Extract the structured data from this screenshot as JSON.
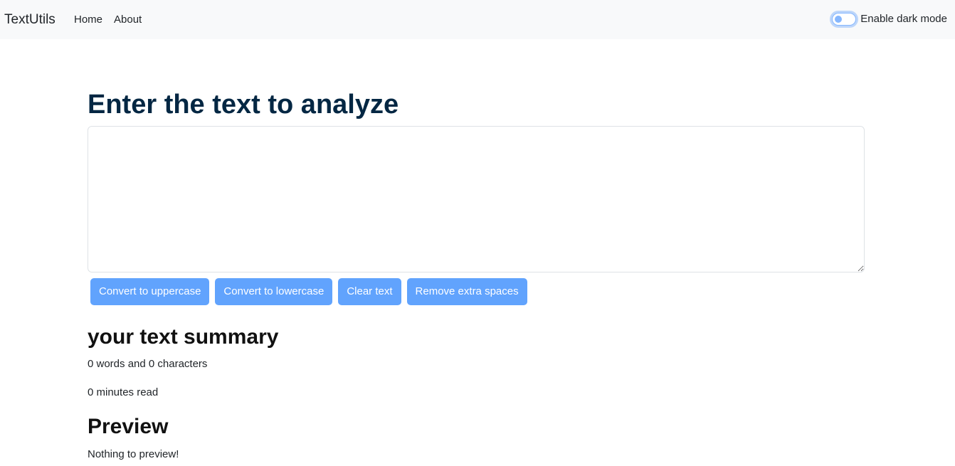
{
  "navbar": {
    "brand": "TextUtils",
    "links": [
      "Home",
      "About"
    ],
    "dark_mode_label": "Enable dark mode"
  },
  "main": {
    "heading": "Enter the text to analyze",
    "textarea_value": "",
    "buttons": [
      "Convert to uppercase",
      "Convert to lowercase",
      "Clear text",
      "Remove extra spaces"
    ]
  },
  "summary": {
    "title": "your text summary",
    "words_line": "0 words and 0 characters",
    "read_line": "0 minutes read"
  },
  "preview": {
    "title": "Preview",
    "text": "Nothing to preview!"
  },
  "colors": {
    "navbar_bg": "#f8f9fa",
    "heading": "#042743",
    "button_bg": "#61a3fd",
    "switch_accent": "#86b7fe"
  }
}
